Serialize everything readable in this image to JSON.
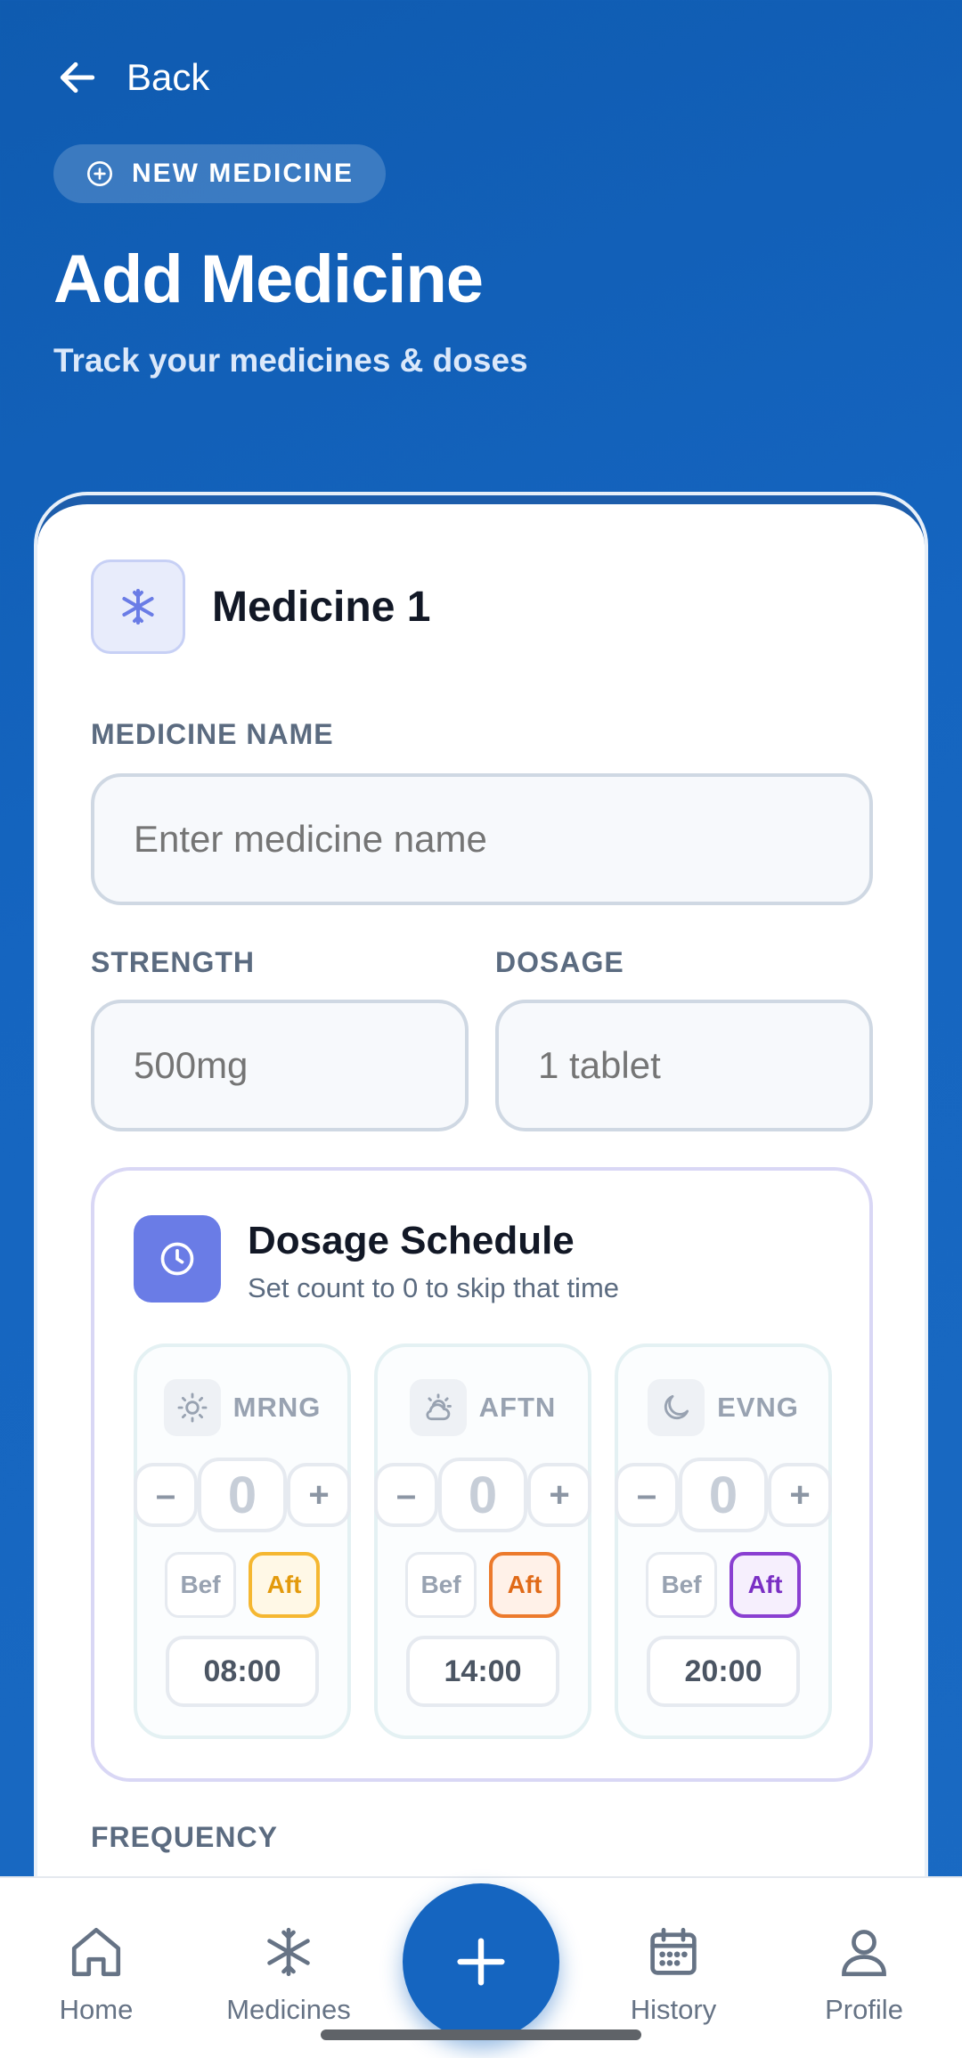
{
  "header": {
    "back_label": "Back",
    "badge_label": "NEW MEDICINE",
    "title": "Add Medicine",
    "subtitle": "Track your medicines & doses"
  },
  "medicine": {
    "title": "Medicine 1",
    "name_label": "MEDICINE NAME",
    "name_placeholder": "Enter medicine name",
    "strength_label": "STRENGTH",
    "strength_placeholder": "500mg",
    "dosage_label": "DOSAGE",
    "dosage_placeholder": "1 tablet"
  },
  "schedule": {
    "title": "Dosage Schedule",
    "subtitle": "Set count to 0 to skip that time",
    "slots": [
      {
        "name": "MRNG",
        "icon": "sun-icon",
        "count": "0",
        "before": "Bef",
        "after": "Aft",
        "selected": "after",
        "accent": "#f5b731",
        "time": "08:00"
      },
      {
        "name": "AFTN",
        "icon": "cloud-sun-icon",
        "count": "0",
        "before": "Bef",
        "after": "Aft",
        "selected": "after",
        "accent": "#ec7a2c",
        "time": "14:00"
      },
      {
        "name": "EVNG",
        "icon": "moon-icon",
        "count": "0",
        "before": "Bef",
        "after": "Aft",
        "selected": "after",
        "accent": "#8a3fd1",
        "time": "20:00"
      }
    ]
  },
  "frequency": {
    "label": "FREQUENCY"
  },
  "nav": {
    "home": "Home",
    "medicines": "Medicines",
    "history": "History",
    "profile": "Profile"
  },
  "colors": {
    "primary": "#1565c0",
    "schedule_accent": "#6a7ce6"
  }
}
